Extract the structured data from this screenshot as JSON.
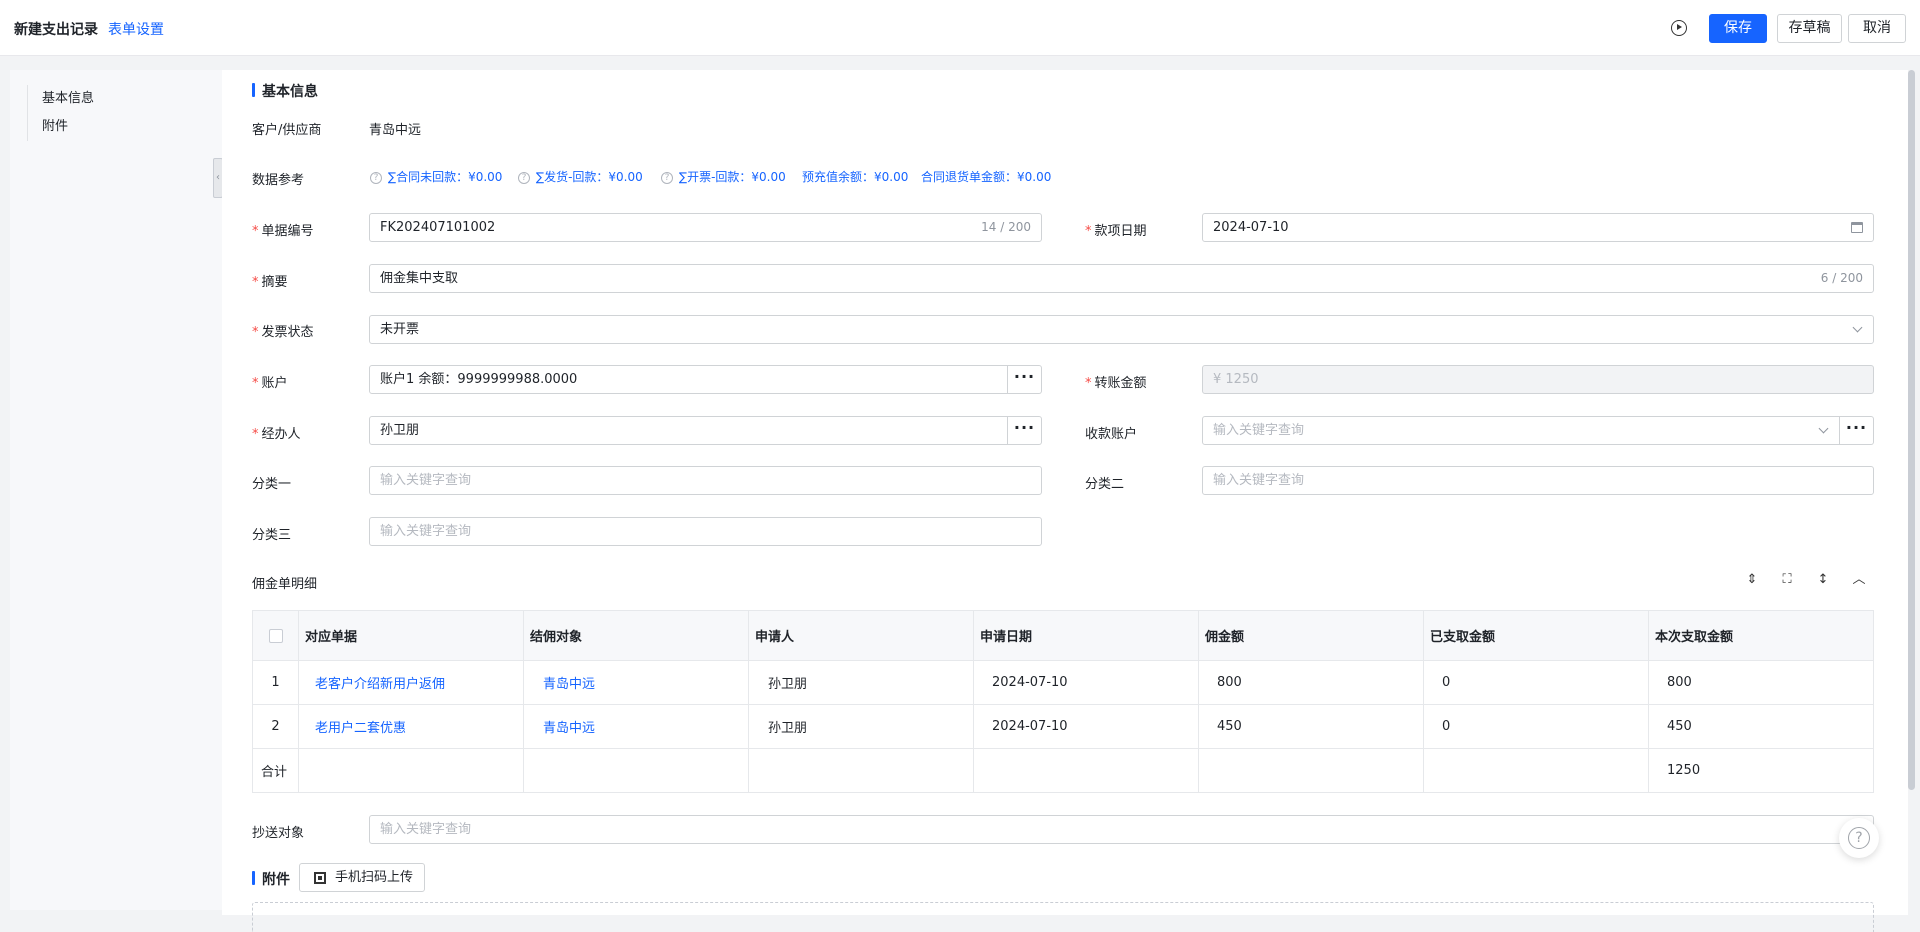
{
  "header": {
    "title": "新建支出记录",
    "settings_link": "表单设置",
    "buttons": {
      "save": "保存",
      "draft": "存草稿",
      "cancel": "取消"
    }
  },
  "nav": {
    "items": [
      "基本信息",
      "附件"
    ]
  },
  "basic": {
    "section_title": "基本信息",
    "customer_label": "客户/供应商",
    "customer_value": "青岛中远",
    "ref_label": "数据参考",
    "refs": [
      "∑合同未回款：¥0.00",
      "∑发货-回款：¥0.00",
      "∑开票-回款：¥0.00",
      "预充值余额：¥0.00",
      "合同退货单金额：¥0.00"
    ],
    "doc_no": {
      "label": "单据编号",
      "value": "FK202407101002",
      "count": "14 / 200"
    },
    "date": {
      "label": "款项日期",
      "value": "2024-07-10"
    },
    "summary": {
      "label": "摘要",
      "value": "佣金集中支取",
      "count": "6 / 200"
    },
    "invoice": {
      "label": "发票状态",
      "value": "未开票"
    },
    "account": {
      "label": "账户",
      "value": "账户1 余额：9999999988.0000"
    },
    "transfer": {
      "label": "转账金额",
      "value": "¥  1250"
    },
    "handler": {
      "label": "经办人",
      "value": "孙卫朋"
    },
    "recv_account": {
      "label": "收款账户",
      "placeholder": "输入关键字查询"
    },
    "cat1": {
      "label": "分类一",
      "placeholder": "输入关键字查询"
    },
    "cat2": {
      "label": "分类二",
      "placeholder": "输入关键字查询"
    },
    "cat3": {
      "label": "分类三",
      "placeholder": "输入关键字查询"
    }
  },
  "detail": {
    "title": "佣金单明细",
    "columns": [
      "对应单据",
      "结佣对象",
      "申请人",
      "申请日期",
      "佣金额",
      "已支取金额",
      "本次支取金额"
    ],
    "rows": [
      {
        "idx": "1",
        "doc": "老客户介绍新用户返佣",
        "target": "青岛中远",
        "applicant": "孙卫朋",
        "date": "2024-07-10",
        "amount": "800",
        "paid": "0",
        "current": "800"
      },
      {
        "idx": "2",
        "doc": "老用户二套优惠",
        "target": "青岛中远",
        "applicant": "孙卫朋",
        "date": "2024-07-10",
        "amount": "450",
        "paid": "0",
        "current": "450"
      }
    ],
    "total_label": "合计",
    "total_current": "1250"
  },
  "cc": {
    "label": "抄送对象",
    "placeholder": "输入关键字查询"
  },
  "attachment": {
    "title": "附件",
    "upload_label": "手机扫码上传"
  },
  "colors": {
    "primary": "#1664ff",
    "required": "#f54a45"
  },
  "icons": [
    "play-icon",
    "calendar-icon",
    "chevron-down-icon",
    "more-icon",
    "row-height-icon",
    "fullscreen-icon",
    "expand-icon",
    "collapse-up-icon",
    "qrcode-icon",
    "help-icon"
  ]
}
